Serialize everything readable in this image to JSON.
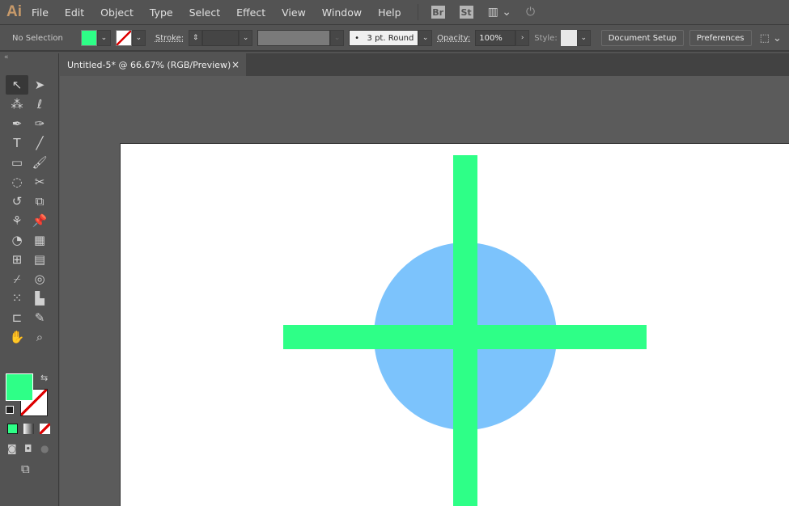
{
  "app": {
    "logo": "Ai",
    "menus": [
      "File",
      "Edit",
      "Object",
      "Type",
      "Select",
      "Effect",
      "View",
      "Window",
      "Help"
    ],
    "bridge": "Br",
    "stock": "St"
  },
  "control": {
    "selection": "No Selection",
    "fill_color": "#2eff87",
    "stroke_label": "Stroke:",
    "brush": "3 pt. Round",
    "opacity_label": "Opacity:",
    "opacity": "100%",
    "style_label": "Style:",
    "document_setup": "Document Setup",
    "preferences": "Preferences"
  },
  "document": {
    "tab": "Untitled-5* @ 66.67% (RGB/Preview)",
    "close": "×"
  },
  "tools": [
    "selection-tool",
    "direct-selection-tool",
    "magic-wand-tool",
    "lasso-tool",
    "pen-tool",
    "curvature-tool",
    "type-tool",
    "line-tool",
    "rectangle-tool",
    "paintbrush-tool",
    "shaper-tool",
    "scissors-tool",
    "rotate-tool",
    "scale-tool",
    "puppet-warp-tool",
    "pin-tool",
    "shape-builder-tool",
    "perspective-grid-tool",
    "mesh-tool",
    "gradient-tool",
    "eyedropper-tool",
    "blend-tool",
    "symbol-sprayer-tool",
    "graph-tool",
    "artboard-tool",
    "slice-tool",
    "hand-tool",
    "zoom-tool"
  ],
  "colors": {
    "fill": "#2eff87",
    "circle": "#7cc3fc",
    "artboard": "#ffffff",
    "stroke": "none"
  }
}
